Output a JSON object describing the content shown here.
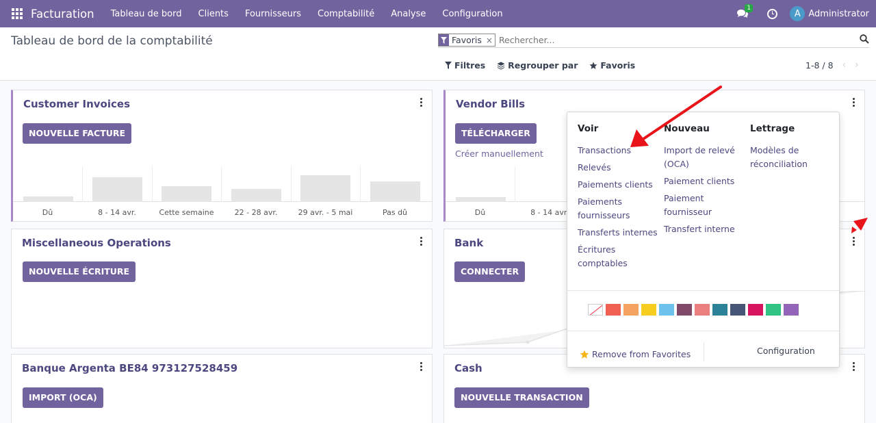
{
  "navbar": {
    "app_name": "Facturation",
    "menu": [
      "Tableau de bord",
      "Clients",
      "Fournisseurs",
      "Comptabilité",
      "Analyse",
      "Configuration"
    ],
    "chat_badge": "1",
    "avatar_letter": "A",
    "user": "Administrator"
  },
  "control_panel": {
    "title": "Tableau de bord de la comptabilité",
    "facet_label": "Favoris",
    "facet_remove": "×",
    "search_placeholder": "Rechercher...",
    "filters_label": "Filtres",
    "groupby_label": "Regrouper par",
    "favorites_label": "Favoris",
    "pager": "1-8 / 8",
    "prev": "‹",
    "next": "›"
  },
  "cards": {
    "customer_invoices": {
      "title": "Customer Invoices",
      "button": "NOUVELLE FACTURE",
      "chart_labels": [
        "Dû",
        "8 - 14 avr.",
        "Cette semaine",
        "22 - 28 avr.",
        "29 avr. - 5 mai",
        "Pas dû"
      ]
    },
    "vendor_bills": {
      "title": "Vendor Bills",
      "button": "TÉLÉCHARGER",
      "link": "Créer manuellement",
      "chart_labels": [
        "Dû",
        "8 - 14 avr."
      ]
    },
    "misc_operations": {
      "title": "Miscellaneous Operations",
      "button": "NOUVELLE ÉCRITURE"
    },
    "bank": {
      "title": "Bank",
      "button": "CONNECTER"
    },
    "banque_argenta": {
      "title": "Banque Argenta BE84 973127528459",
      "button": "IMPORT (OCA)"
    },
    "cash": {
      "title": "Cash",
      "button": "NOUVELLE TRANSACTION"
    }
  },
  "dropdown": {
    "voir": {
      "heading": "Voir",
      "items": [
        "Transactions",
        "Relevés",
        "Paiements clients",
        "Paiements fournisseurs",
        "Transferts internes",
        "Écritures comptables"
      ]
    },
    "nouveau": {
      "heading": "Nouveau",
      "items": [
        "Import de relevé (OCA)",
        "Paiement clients",
        "Paiement fournisseur",
        "Transfert interne"
      ]
    },
    "lettrage": {
      "heading": "Lettrage",
      "items": [
        "Modèles de réconciliation"
      ]
    },
    "colors": [
      "none",
      "#f06050",
      "#f4a460",
      "#f7cd1f",
      "#6cc1ed",
      "#814968",
      "#eb7e7f",
      "#2c8397",
      "#475577",
      "#d6145f",
      "#30c381",
      "#9365b8"
    ],
    "remove_favorites": "Remove from Favorites",
    "configuration": "Configuration"
  }
}
